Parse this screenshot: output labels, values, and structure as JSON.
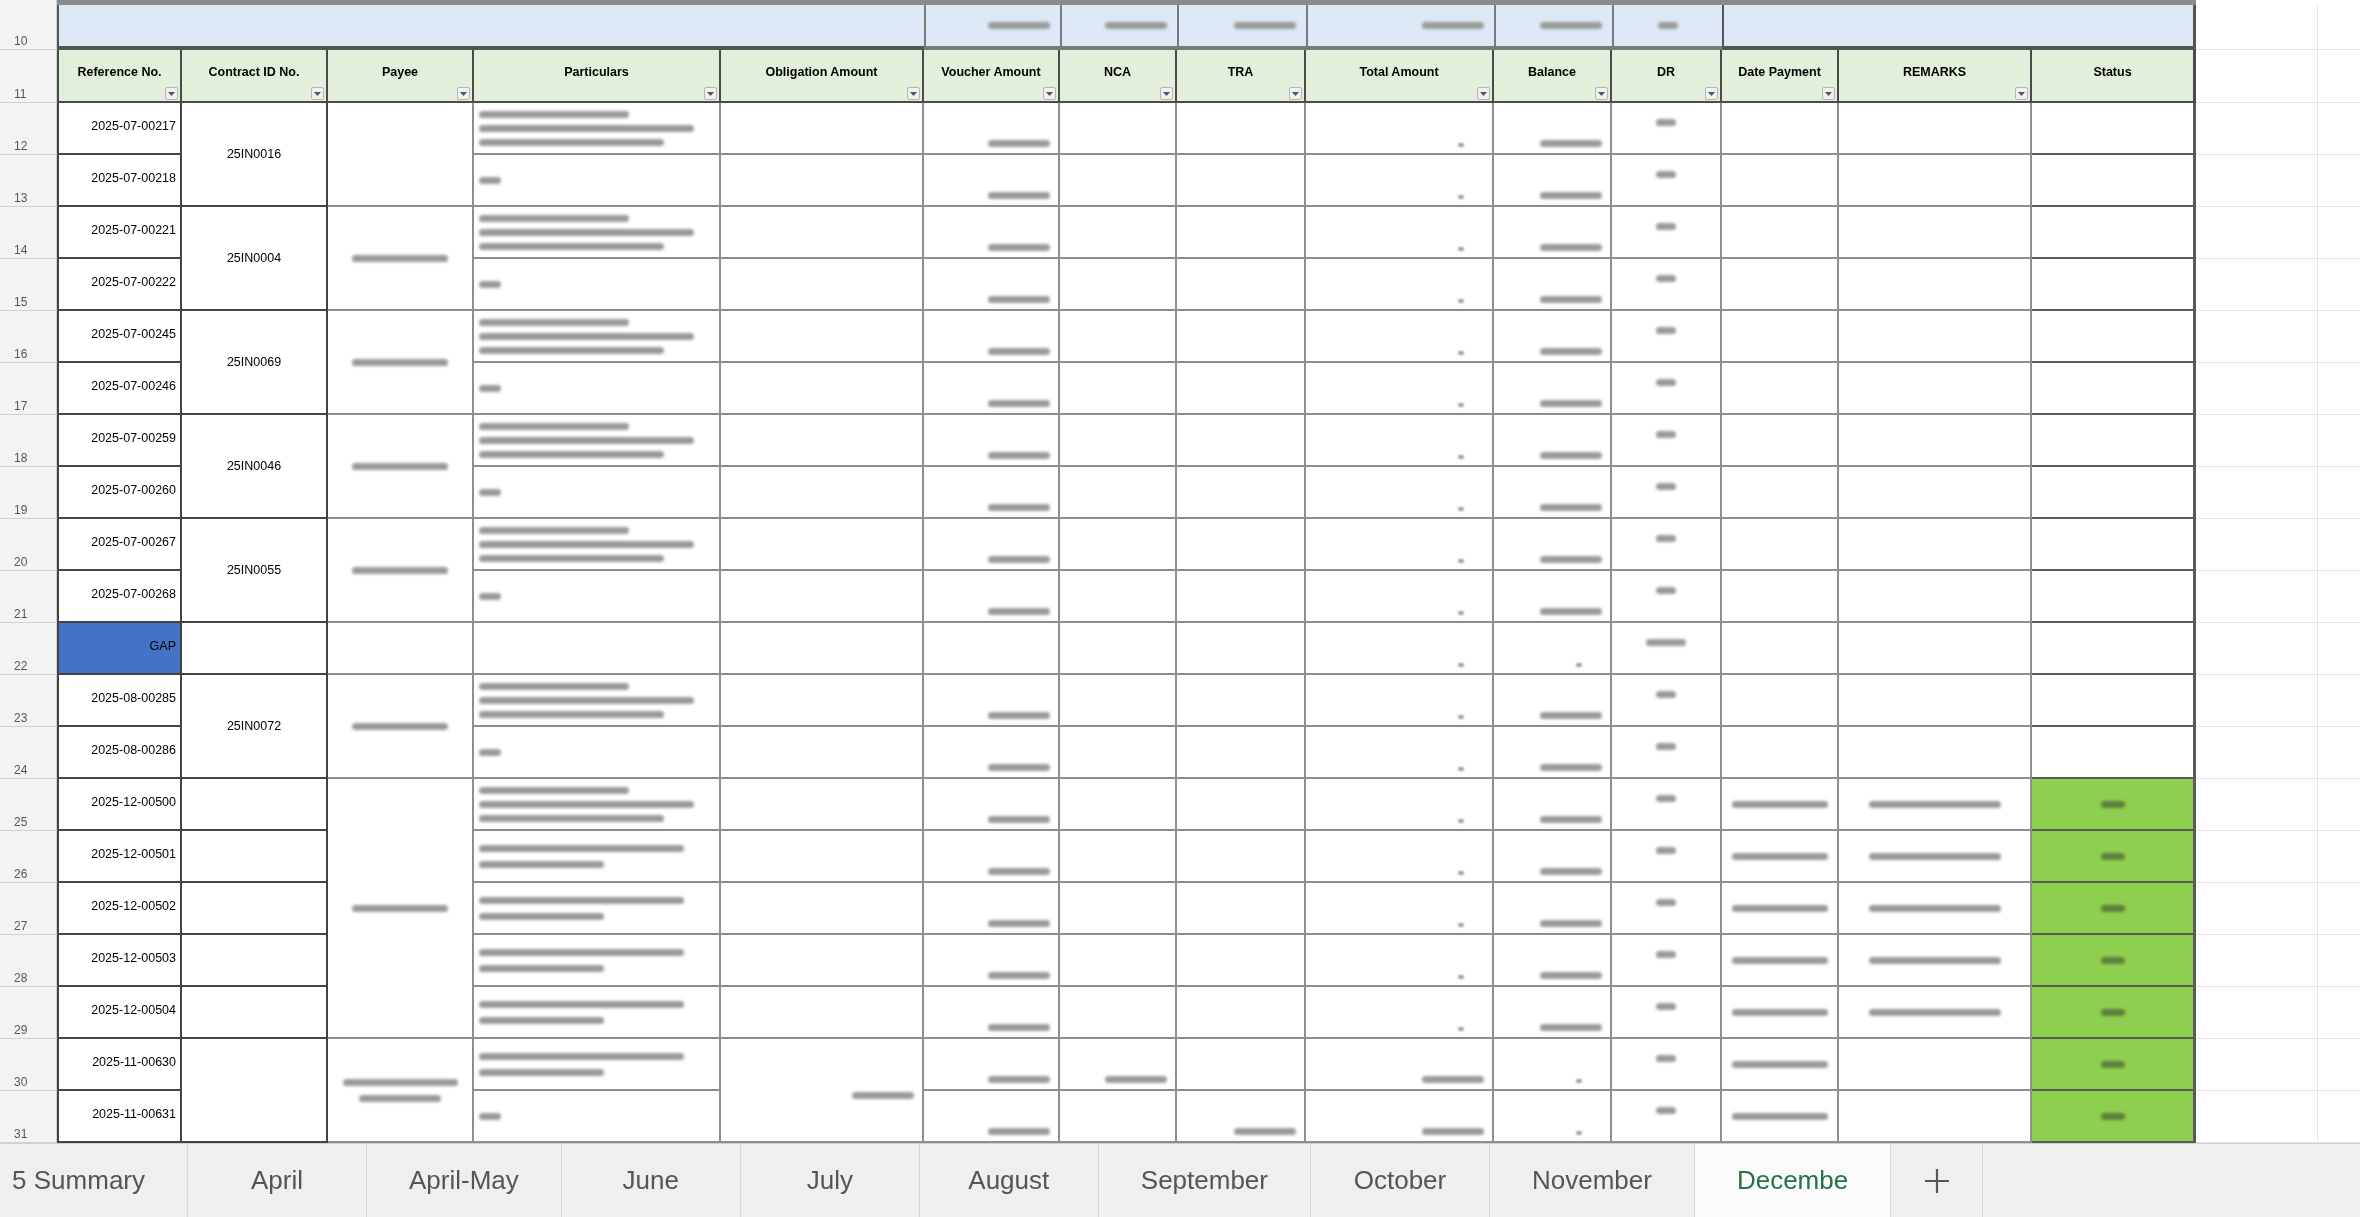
{
  "sheet": {
    "summary_row": {
      "number": "10",
      "blurred": {
        "voucher_amount": {
          "kind": "figure"
        },
        "nca": {
          "kind": "figure"
        },
        "tra": {
          "kind": "figure"
        },
        "total_amount": {
          "kind": "figure"
        },
        "balance": {
          "kind": "figure"
        },
        "dr": {
          "kind": "percent"
        }
      }
    },
    "header_row": {
      "number": "11"
    },
    "columns": [
      {
        "label": "Reference No.",
        "filter": true
      },
      {
        "label": "Contract ID No.",
        "filter": true
      },
      {
        "label": "Payee",
        "filter": true
      },
      {
        "label": "Particulars",
        "filter": true
      },
      {
        "label": "Obligation Amount",
        "filter": true
      },
      {
        "label": "Voucher Amount",
        "filter": true
      },
      {
        "label": "NCA",
        "filter": true
      },
      {
        "label": "TRA",
        "filter": true
      },
      {
        "label": "Total Amount",
        "filter": true
      },
      {
        "label": "Balance",
        "filter": true
      },
      {
        "label": "DR",
        "filter": true
      },
      {
        "label": "Date Payment",
        "filter": true
      },
      {
        "label": "REMARKS",
        "filter": true
      },
      {
        "label": "Status",
        "filter": false
      }
    ],
    "payee_groups": [
      {
        "contract_groups": [
          {
            "contract": "25IN0016",
            "rows": [
              {
                "number": "12",
                "reference": "2025-07-00217",
                "highlight": false,
                "blurred": {
                  "particulars": {
                    "kind": "paragraph"
                  },
                  "voucher_amount": {
                    "kind": "figure"
                  },
                  "total_amount": {
                    "kind": "dash"
                  },
                  "balance": {
                    "kind": "figure"
                  },
                  "dr": {
                    "kind": "percent"
                  }
                }
              },
              {
                "number": "13",
                "reference": "2025-07-00218",
                "highlight": false,
                "blurred": {
                  "particulars": {
                    "kind": "word"
                  },
                  "voucher_amount": {
                    "kind": "figure"
                  },
                  "total_amount": {
                    "kind": "dash"
                  },
                  "balance": {
                    "kind": "figure"
                  },
                  "dr": {
                    "kind": "percent"
                  }
                }
              }
            ]
          }
        ]
      },
      {
        "blurred": {
          "payee": {
            "kind": "name"
          }
        },
        "contract_groups": [
          {
            "contract": "25IN0004",
            "rows": [
              {
                "number": "14",
                "reference": "2025-07-00221",
                "highlight": false,
                "blurred": {
                  "particulars": {
                    "kind": "paragraph"
                  },
                  "voucher_amount": {
                    "kind": "figure"
                  },
                  "total_amount": {
                    "kind": "dash"
                  },
                  "balance": {
                    "kind": "figure"
                  },
                  "dr": {
                    "kind": "percent"
                  }
                }
              },
              {
                "number": "15",
                "reference": "2025-07-00222",
                "highlight": false,
                "blurred": {
                  "particulars": {
                    "kind": "word"
                  },
                  "voucher_amount": {
                    "kind": "figure"
                  },
                  "total_amount": {
                    "kind": "dash"
                  },
                  "balance": {
                    "kind": "figure"
                  },
                  "dr": {
                    "kind": "percent"
                  }
                }
              }
            ]
          }
        ]
      },
      {
        "blurred": {
          "payee": {
            "kind": "name"
          }
        },
        "contract_groups": [
          {
            "contract": "25IN0069",
            "rows": [
              {
                "number": "16",
                "reference": "2025-07-00245",
                "highlight": false,
                "blurred": {
                  "particulars": {
                    "kind": "paragraph"
                  },
                  "voucher_amount": {
                    "kind": "figure"
                  },
                  "total_amount": {
                    "kind": "dash"
                  },
                  "balance": {
                    "kind": "figure"
                  },
                  "dr": {
                    "kind": "percent"
                  }
                }
              },
              {
                "number": "17",
                "reference": "2025-07-00246",
                "highlight": false,
                "blurred": {
                  "particulars": {
                    "kind": "word"
                  },
                  "voucher_amount": {
                    "kind": "figure"
                  },
                  "total_amount": {
                    "kind": "dash"
                  },
                  "balance": {
                    "kind": "figure"
                  },
                  "dr": {
                    "kind": "percent"
                  }
                }
              }
            ]
          }
        ]
      },
      {
        "blurred": {
          "payee": {
            "kind": "name"
          }
        },
        "contract_groups": [
          {
            "contract": "25IN0046",
            "rows": [
              {
                "number": "18",
                "reference": "2025-07-00259",
                "highlight": false,
                "blurred": {
                  "particulars": {
                    "kind": "paragraph"
                  },
                  "voucher_amount": {
                    "kind": "figure"
                  },
                  "total_amount": {
                    "kind": "dash"
                  },
                  "balance": {
                    "kind": "figure"
                  },
                  "dr": {
                    "kind": "percent"
                  }
                }
              },
              {
                "number": "19",
                "reference": "2025-07-00260",
                "highlight": false,
                "blurred": {
                  "particulars": {
                    "kind": "word"
                  },
                  "voucher_amount": {
                    "kind": "figure"
                  },
                  "total_amount": {
                    "kind": "dash"
                  },
                  "balance": {
                    "kind": "figure"
                  },
                  "dr": {
                    "kind": "percent"
                  }
                }
              }
            ]
          }
        ]
      },
      {
        "blurred": {
          "payee": {
            "kind": "name"
          }
        },
        "contract_groups": [
          {
            "contract": "25IN0055",
            "rows": [
              {
                "number": "20",
                "reference": "2025-07-00267",
                "highlight": false,
                "blurred": {
                  "particulars": {
                    "kind": "paragraph"
                  },
                  "voucher_amount": {
                    "kind": "figure"
                  },
                  "total_amount": {
                    "kind": "dash"
                  },
                  "balance": {
                    "kind": "figure"
                  },
                  "dr": {
                    "kind": "percent"
                  }
                }
              },
              {
                "number": "21",
                "reference": "2025-07-00268",
                "highlight": false,
                "blurred": {
                  "particulars": {
                    "kind": "word"
                  },
                  "voucher_amount": {
                    "kind": "figure"
                  },
                  "total_amount": {
                    "kind": "dash"
                  },
                  "balance": {
                    "kind": "figure"
                  },
                  "dr": {
                    "kind": "percent"
                  }
                }
              }
            ]
          }
        ]
      },
      {
        "contract_groups": [
          {
            "rows": [
              {
                "number": "22",
                "reference": "GAP",
                "highlight": true,
                "blurred": {
                  "total_amount": {
                    "kind": "dash"
                  },
                  "balance": {
                    "kind": "dash"
                  },
                  "dr": {
                    "kind": "error"
                  }
                }
              }
            ]
          }
        ]
      },
      {
        "blurred": {
          "payee": {
            "kind": "name"
          }
        },
        "contract_groups": [
          {
            "contract": "25IN0072",
            "rows": [
              {
                "number": "23",
                "reference": "2025-08-00285",
                "highlight": false,
                "blurred": {
                  "particulars": {
                    "kind": "paragraph"
                  },
                  "voucher_amount": {
                    "kind": "figure"
                  },
                  "total_amount": {
                    "kind": "dash"
                  },
                  "balance": {
                    "kind": "figure"
                  },
                  "dr": {
                    "kind": "percent"
                  }
                }
              },
              {
                "number": "24",
                "reference": "2025-08-00286",
                "highlight": false,
                "blurred": {
                  "particulars": {
                    "kind": "word"
                  },
                  "voucher_amount": {
                    "kind": "figure"
                  },
                  "total_amount": {
                    "kind": "dash"
                  },
                  "balance": {
                    "kind": "figure"
                  },
                  "dr": {
                    "kind": "percent"
                  }
                }
              }
            ]
          }
        ]
      },
      {
        "blurred": {
          "payee": {
            "kind": "name"
          }
        },
        "contract_groups": [
          {
            "rows": [
              {
                "number": "25",
                "reference": "2025-12-00500",
                "highlight": false,
                "color": "#8fcf4f",
                "blurred": {
                  "particulars": {
                    "kind": "paragraph"
                  },
                  "voucher_amount": {
                    "kind": "figure"
                  },
                  "total_amount": {
                    "kind": "dash"
                  },
                  "balance": {
                    "kind": "figure"
                  },
                  "dr": {
                    "kind": "percent"
                  },
                  "date_payment": {
                    "kind": "date"
                  },
                  "remarks": {
                    "kind": "note"
                  },
                  "status": {
                    "kind": "status"
                  }
                }
              }
            ]
          },
          {
            "rows": [
              {
                "number": "26",
                "reference": "2025-12-00501",
                "highlight": false,
                "color": "#8fcf4f",
                "blurred": {
                  "particulars": {
                    "kind": "twoline"
                  },
                  "voucher_amount": {
                    "kind": "figure"
                  },
                  "total_amount": {
                    "kind": "dash"
                  },
                  "balance": {
                    "kind": "figure"
                  },
                  "dr": {
                    "kind": "percent"
                  },
                  "date_payment": {
                    "kind": "date"
                  },
                  "remarks": {
                    "kind": "note"
                  },
                  "status": {
                    "kind": "status"
                  }
                }
              }
            ]
          },
          {
            "rows": [
              {
                "number": "27",
                "reference": "2025-12-00502",
                "highlight": false,
                "color": "#8fcf4f",
                "blurred": {
                  "particulars": {
                    "kind": "twoline"
                  },
                  "voucher_amount": {
                    "kind": "figure"
                  },
                  "total_amount": {
                    "kind": "dash"
                  },
                  "balance": {
                    "kind": "figure"
                  },
                  "dr": {
                    "kind": "percent"
                  },
                  "date_payment": {
                    "kind": "date"
                  },
                  "remarks": {
                    "kind": "note"
                  },
                  "status": {
                    "kind": "status"
                  }
                }
              }
            ]
          },
          {
            "rows": [
              {
                "number": "28",
                "reference": "2025-12-00503",
                "highlight": false,
                "color": "#8fcf4f",
                "blurred": {
                  "particulars": {
                    "kind": "twoline"
                  },
                  "voucher_amount": {
                    "kind": "figure"
                  },
                  "total_amount": {
                    "kind": "dash"
                  },
                  "balance": {
                    "kind": "figure"
                  },
                  "dr": {
                    "kind": "percent"
                  },
                  "date_payment": {
                    "kind": "date"
                  },
                  "remarks": {
                    "kind": "note"
                  },
                  "status": {
                    "kind": "status"
                  }
                }
              }
            ]
          },
          {
            "rows": [
              {
                "number": "29",
                "reference": "2025-12-00504",
                "highlight": false,
                "color": "#8fcf4f",
                "blurred": {
                  "particulars": {
                    "kind": "twoline"
                  },
                  "voucher_amount": {
                    "kind": "figure"
                  },
                  "total_amount": {
                    "kind": "dash"
                  },
                  "balance": {
                    "kind": "figure"
                  },
                  "dr": {
                    "kind": "percent"
                  },
                  "date_payment": {
                    "kind": "date"
                  },
                  "remarks": {
                    "kind": "note"
                  },
                  "status": {
                    "kind": "status"
                  }
                }
              }
            ]
          }
        ]
      },
      {
        "blurred": {
          "payee": {
            "kind": "fullname"
          }
        },
        "contract_groups": [
          {
            "blurred": {
              "obligation_amount": {
                "kind": "figure"
              }
            },
            "rows": [
              {
                "number": "30",
                "reference": "2025-11-00630",
                "highlight": false,
                "color": "#8fcf4f",
                "blurred": {
                  "particulars": {
                    "kind": "twoline"
                  },
                  "voucher_amount": {
                    "kind": "figure"
                  },
                  "nca": {
                    "kind": "figure"
                  },
                  "total_amount": {
                    "kind": "figure"
                  },
                  "balance": {
                    "kind": "dash"
                  },
                  "dr": {
                    "kind": "percent"
                  },
                  "date_payment": {
                    "kind": "date"
                  },
                  "status": {
                    "kind": "status"
                  }
                }
              },
              {
                "number": "31",
                "reference": "2025-11-00631",
                "highlight": false,
                "color": "#8fcf4f",
                "blurred": {
                  "particulars": {
                    "kind": "word"
                  },
                  "voucher_amount": {
                    "kind": "figure"
                  },
                  "tra": {
                    "kind": "figure"
                  },
                  "total_amount": {
                    "kind": "figure"
                  },
                  "balance": {
                    "kind": "dash"
                  },
                  "dr": {
                    "kind": "percent"
                  },
                  "date_payment": {
                    "kind": "date"
                  },
                  "status": {
                    "kind": "status"
                  }
                }
              }
            ]
          }
        ]
      }
    ]
  },
  "tabs": [
    {
      "label": "5 Summary",
      "selected": false
    },
    {
      "label": "April",
      "selected": false
    },
    {
      "label": "April-May",
      "selected": false
    },
    {
      "label": "June",
      "selected": false
    },
    {
      "label": "July",
      "selected": false
    },
    {
      "label": "August",
      "selected": false
    },
    {
      "label": "September",
      "selected": false
    },
    {
      "label": "October",
      "selected": false
    },
    {
      "label": "November",
      "selected": false
    },
    {
      "label": "Decembe",
      "selected": true
    }
  ]
}
